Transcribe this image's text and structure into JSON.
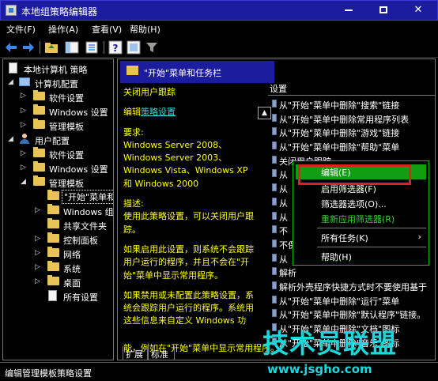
{
  "window": {
    "title": "本地组策略编辑器",
    "minimize_symbol": "—",
    "maximize_symbol": "□",
    "close_symbol": "✕"
  },
  "menu": [
    "文件(F)",
    "操作(A)",
    "查看(V)",
    "帮助(H)"
  ],
  "toolbar": {
    "back_icon": "arrow-left",
    "forward_icon": "arrow-right",
    "help_label": "?"
  },
  "tree": [
    {
      "label": "本地计算机 策略",
      "icon": "document",
      "level": 0
    },
    {
      "label": "计算机配置",
      "icon": "computer",
      "level": 1
    },
    {
      "label": "软件设置",
      "icon": "folder",
      "level": 2
    },
    {
      "label": "Windows 设置",
      "icon": "folder",
      "level": 2
    },
    {
      "label": "管理模板",
      "icon": "folder",
      "level": 2
    },
    {
      "label": "用户配置",
      "icon": "user",
      "level": 1
    },
    {
      "label": "软件设置",
      "icon": "folder",
      "level": 2
    },
    {
      "label": "Windows 设置",
      "icon": "folder",
      "level": 2
    },
    {
      "label": "管理模板",
      "icon": "folder",
      "level": 2
    },
    {
      "label": "\"开始\"菜单和",
      "icon": "folder",
      "level": 3,
      "selected": true
    },
    {
      "label": "Windows 组",
      "icon": "folder",
      "level": 3
    },
    {
      "label": "共享文件夹",
      "icon": "folder",
      "level": 3
    },
    {
      "label": "控制面板",
      "icon": "folder",
      "level": 3
    },
    {
      "label": "网络",
      "icon": "folder",
      "level": 3
    },
    {
      "label": "系统",
      "icon": "folder",
      "level": 3
    },
    {
      "label": "桌面",
      "icon": "folder",
      "level": 3
    },
    {
      "label": "所有设置",
      "icon": "document",
      "level": 3
    }
  ],
  "detail": {
    "header": "\"开始\"菜单和任务栏",
    "column_header": "设置",
    "policy_title": "关闭用户跟踪",
    "edit_prefix": "编辑",
    "edit_link": "策略设置",
    "requirements_label": "要求:",
    "requirements_lines": [
      "Windows Server 2008、",
      "Windows Server 2003、",
      "Windows Vista、Windows XP",
      "和 Windows 2000"
    ],
    "description_label": "描述:",
    "description_lines": [
      "使用此策略设置，可以关闭用户跟",
      "踪。"
    ],
    "enabled_lines": [
      "如果启用此设置，则系统不会跟踪",
      "用户运行的程序，并且不会在\"开",
      "始\"菜单中显示常用程序。"
    ],
    "disabled_lines": [
      "如果禁用或未配置此策略设置，系",
      "统会跟踪用户运行的程序。系统用",
      "这些信息来自定义 Windows 功"
    ],
    "cut_line": "能，例如在\"开始\"菜单中显示常用程序。"
  },
  "settings": [
    "从\"开始\"菜单中删除\"搜索\"链接",
    "从\"开始\"菜单中删除常用程序列表",
    "从\"开始\"菜单中删除\"游戏\"链接",
    "从\"开始\"菜单中删除\"帮助\"菜单",
    "关闭用户跟踪",
    "从",
    "从",
    "从",
    "从",
    "不",
    "不保留",
    "从",
    "解析",
    "解析外壳程序快捷方式时不要使用基于",
    "从\"开始\"菜单中删除\"运行\"菜单",
    "从\"开始\"菜单中删除\"默认程序\"链接。",
    "从\"开始\"菜单中删除\"文档\"图标",
    "从\"开始\"菜单中删除\"音乐\"图标"
  ],
  "context_menu": {
    "items": [
      {
        "label": "编辑(E)",
        "active": true
      },
      {
        "label": "启用筛选器(F)"
      },
      {
        "label": "筛选器选项(O)..."
      },
      {
        "label": "重新应用筛选器(R)",
        "green": true
      },
      {
        "label": "所有任务(K)",
        "submenu_arrow": "›"
      },
      {
        "label": "帮助(H)"
      }
    ]
  },
  "tabs": [
    "扩展",
    "标准"
  ],
  "status": "编辑管理模板策略设置",
  "watermark": {
    "brand": "技术员联盟",
    "url": "www.jsgho.com"
  },
  "colors": {
    "titlebar": "#1c1c9e",
    "description_text": "#ffff00",
    "link": "#29d6d6",
    "menu_highlight": "#119d11",
    "annotation_box": "#e02020",
    "watermark": "#19d8dc"
  }
}
